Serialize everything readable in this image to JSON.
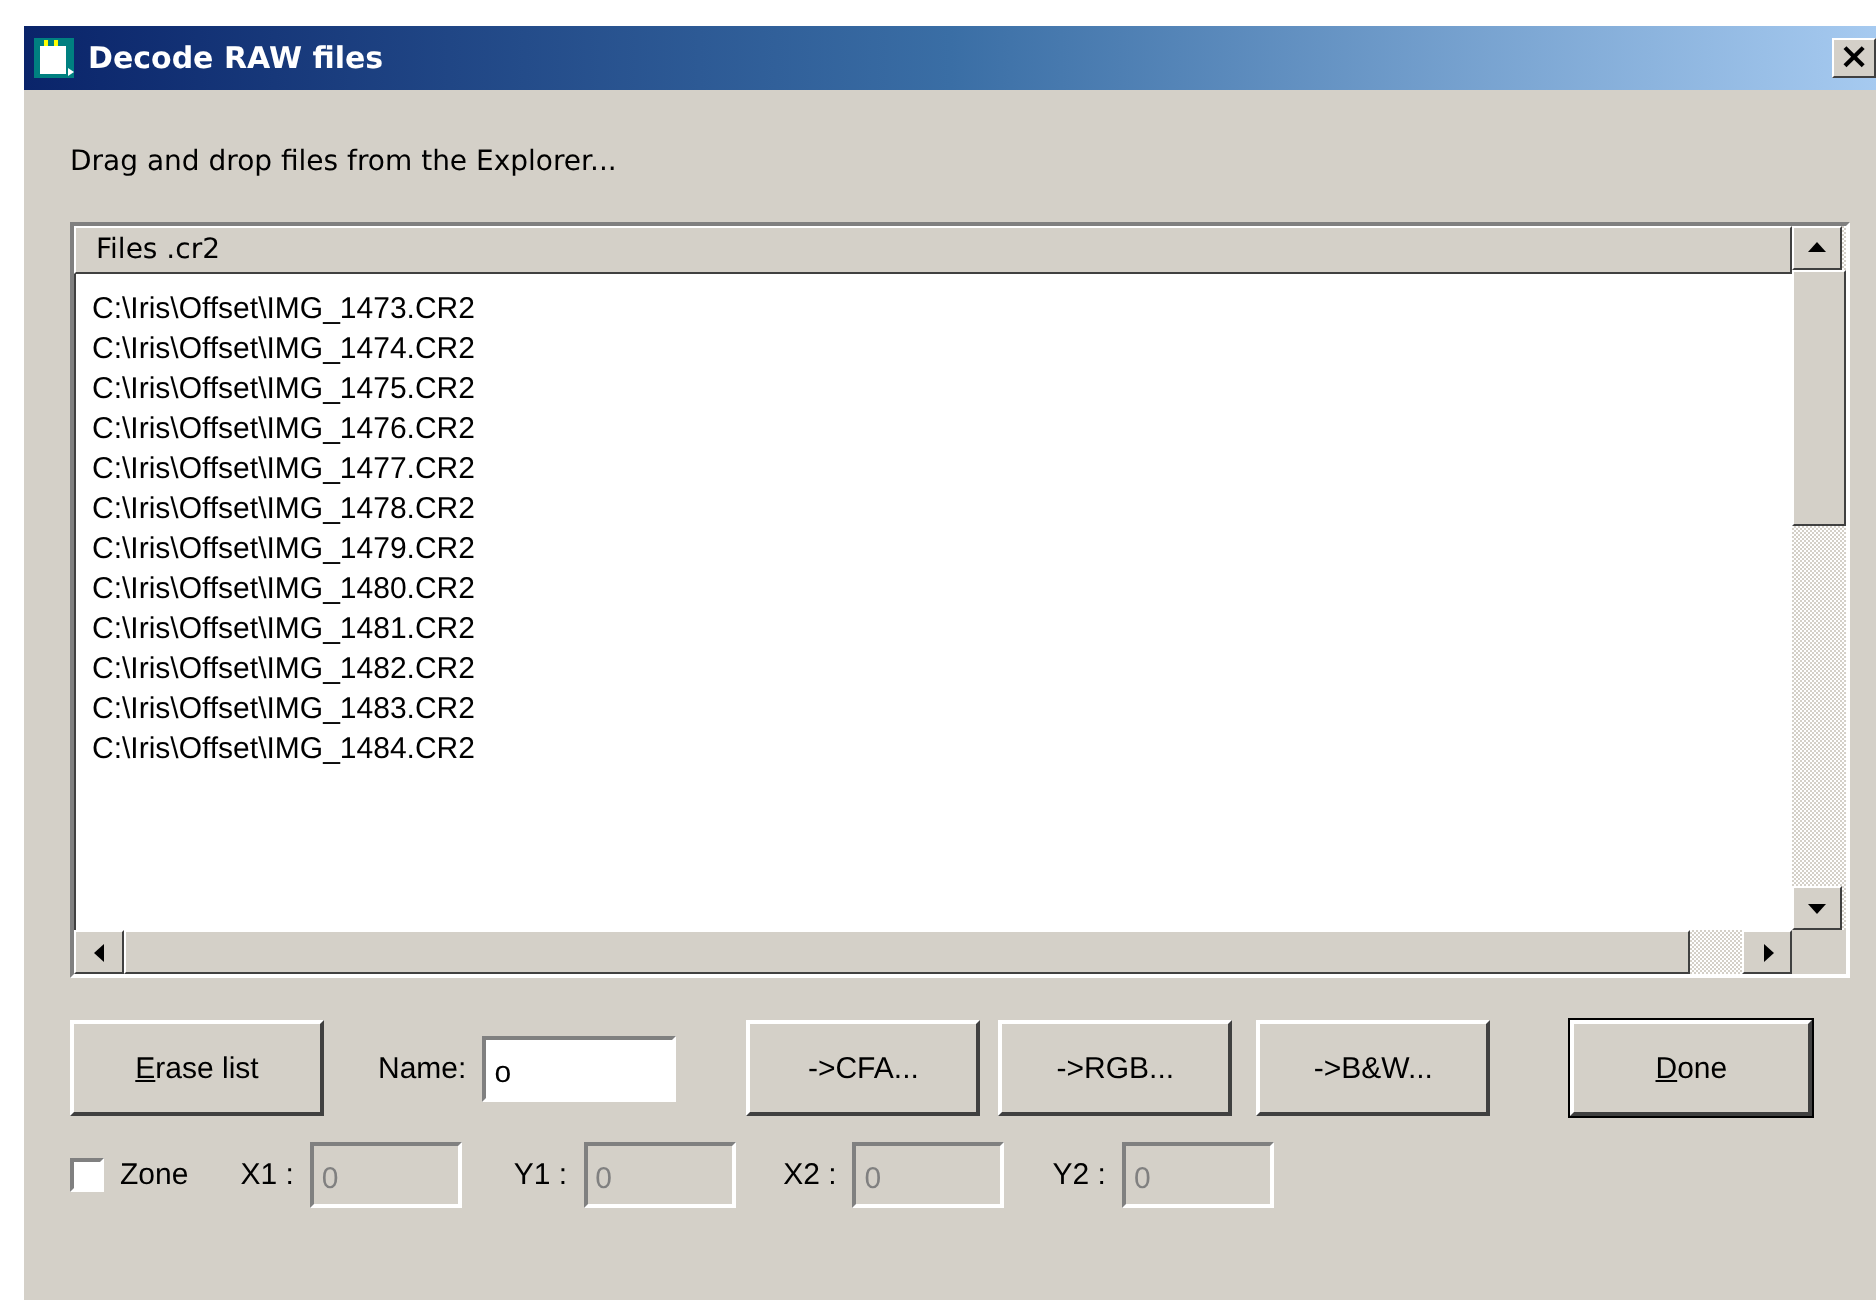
{
  "window": {
    "title": "Decode RAW files",
    "close": "×"
  },
  "instruction": "Drag and drop files from the Explorer...",
  "file_list": {
    "column": "Files .cr2",
    "rows": [
      "C:\\Iris\\Offset\\IMG_1473.CR2",
      "C:\\Iris\\Offset\\IMG_1474.CR2",
      "C:\\Iris\\Offset\\IMG_1475.CR2",
      "C:\\Iris\\Offset\\IMG_1476.CR2",
      "C:\\Iris\\Offset\\IMG_1477.CR2",
      "C:\\Iris\\Offset\\IMG_1478.CR2",
      "C:\\Iris\\Offset\\IMG_1479.CR2",
      "C:\\Iris\\Offset\\IMG_1480.CR2",
      "C:\\Iris\\Offset\\IMG_1481.CR2",
      "C:\\Iris\\Offset\\IMG_1482.CR2",
      "C:\\Iris\\Offset\\IMG_1483.CR2",
      "C:\\Iris\\Offset\\IMG_1484.CR2"
    ]
  },
  "actions": [
    {
      "kind": "button",
      "label": "Erase list",
      "underline_first": true,
      "default": false
    },
    {
      "kind": "field",
      "label": "Name:",
      "value": "o"
    },
    {
      "kind": "button",
      "label": "->CFA...",
      "underline_first": false,
      "default": false
    },
    {
      "kind": "button",
      "label": "->RGB...",
      "underline_first": false,
      "default": false
    },
    {
      "kind": "button",
      "label": "->B&W...",
      "underline_first": false,
      "default": false
    },
    {
      "kind": "button",
      "label": "Done",
      "underline_first": true,
      "default": true
    }
  ],
  "zone": {
    "label": "Zone",
    "checked": false,
    "coords": [
      {
        "label": "X1 :",
        "value": "0",
        "disabled": true
      },
      {
        "label": "Y1 :",
        "value": "0",
        "disabled": true
      },
      {
        "label": "X2 :",
        "value": "0",
        "disabled": true
      },
      {
        "label": "Y2 :",
        "value": "0",
        "disabled": true
      }
    ]
  }
}
